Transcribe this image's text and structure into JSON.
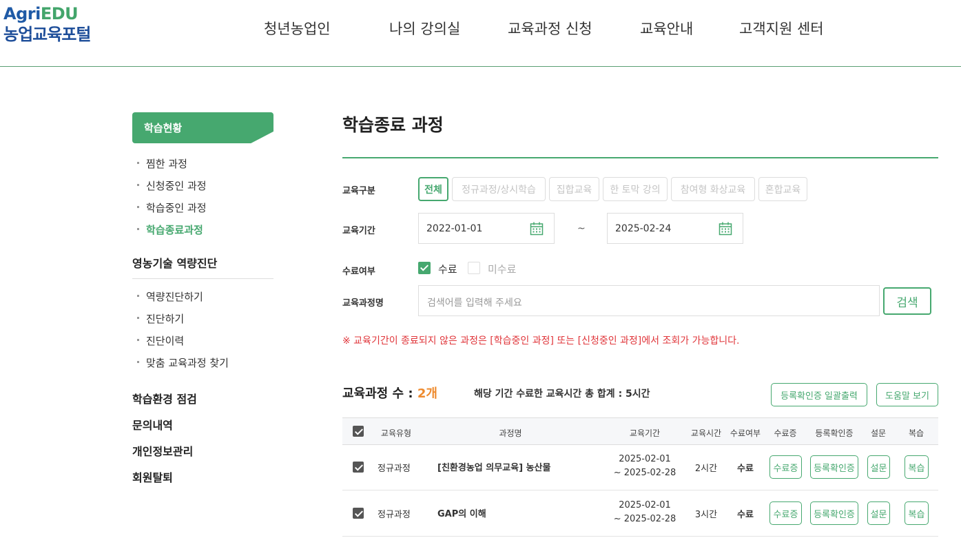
{
  "logo": {
    "top_a": "Agri",
    "top_b": "EDU",
    "bottom": "농업교육포털"
  },
  "nav": [
    "청년농업인",
    "나의 강의실",
    "교육과정 신청",
    "교육안내",
    "고객지원 센터"
  ],
  "sidebar": {
    "active_section": "학습현황",
    "learning_items": [
      "찜한 과정",
      "신청중인 과정",
      "학습중인 과정",
      "학습종료과정"
    ],
    "diagnosis_section": "영농기술 역량진단",
    "diagnosis_items": [
      "역량진단하기",
      "진단하기",
      "진단이력",
      "맞춤 교육과정 찾기"
    ],
    "other_sections": [
      "학습환경 점검",
      "문의내역",
      "개인정보관리",
      "회원탈퇴"
    ]
  },
  "page": {
    "title": "학습종료 과정"
  },
  "filters": {
    "type_label": "교육구분",
    "types": [
      "전체",
      "정규과정/상시학습",
      "집합교육",
      "한 토막 강의",
      "참여형 화상교육",
      "혼합교육"
    ],
    "period_label": "교육기간",
    "date_from": "2022-01-01",
    "date_to": "2025-02-24",
    "tilde": "~",
    "completion_label": "수료여부",
    "completed": "수료",
    "not_completed": "미수료",
    "course_name_label": "교육과정명",
    "search_placeholder": "검색어를 입력해 주세요",
    "search_button": "검색"
  },
  "notice": "※ 교육기간이 종료되지 않은 과정은 [학습중인 과정] 또는 [신청중인 과정]에서 조회가 가능합니다.",
  "summary": {
    "count_label": "교육과정 수 : ",
    "count_value": "2개",
    "total_hours": "해당 기간 수료한 교육시간 총 합계 : 5시간",
    "bulk_print_button": "등록확인증 일괄출력",
    "help_button": "도움말 보기"
  },
  "table": {
    "headers": [
      "교육유형",
      "과정명",
      "교육기간",
      "교육시간",
      "수료여부",
      "수료증",
      "등록확인증",
      "설문",
      "복습"
    ],
    "rows": [
      {
        "type": "정규과정",
        "name": "[친환경농업 의무교육] 농산물",
        "start": "2025-02-01",
        "end": "~ 2025-02-28",
        "hours": "2시간",
        "status": "수료",
        "certificate": "수료증",
        "registration": "등록확인증",
        "survey": "설문",
        "review": "복습"
      },
      {
        "type": "정규과정",
        "name": "GAP의 이해",
        "start": "2025-02-01",
        "end": "~ 2025-02-28",
        "hours": "3시간",
        "status": "수료",
        "certificate": "수료증",
        "registration": "등록확인증",
        "survey": "설문",
        "review": "복습"
      }
    ]
  },
  "colors": {
    "accent": "#46a86f",
    "count": "#ee8b2f",
    "notice": "#e0353a"
  },
  "icons": {
    "calendar": "calendar-icon",
    "check": "check-icon"
  }
}
